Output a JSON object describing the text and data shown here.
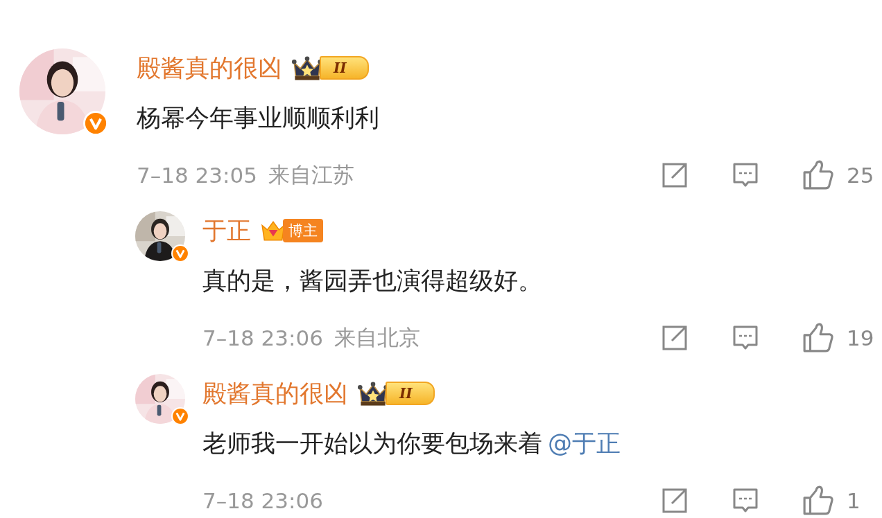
{
  "comments": [
    {
      "name": "殿酱真的很凶",
      "badge": {
        "kind": "level",
        "label": "II"
      },
      "verified": true,
      "text": "杨幂今年事业顺顺利利",
      "time": "7–18 23:05",
      "location": "来自江苏",
      "likes": "25",
      "children": [
        {
          "name": "于正",
          "badge": {
            "kind": "blogger",
            "label": "博主"
          },
          "verified": true,
          "text": "真的是，酱园弄也演得超级好。",
          "time": "7–18 23:06",
          "location": "来自北京",
          "likes": "19"
        },
        {
          "name": "殿酱真的很凶",
          "badge": {
            "kind": "level",
            "label": "II"
          },
          "verified": true,
          "text": "老师我一开始以为你要包场来着",
          "mention": "@于正",
          "time": "7–18 23:06",
          "likes": "1"
        }
      ]
    }
  ]
}
